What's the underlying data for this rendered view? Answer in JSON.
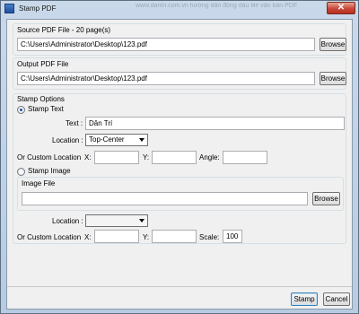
{
  "window": {
    "title": "Stamp PDF",
    "close_glyph": "✕",
    "background_text": "www.dantri.com.vn hướng dẫn đóng dấu file văn bản PDF"
  },
  "source": {
    "label": "Source PDF File - 20 page(s)",
    "path": "C:\\Users\\Administrator\\Desktop\\123.pdf",
    "browse_label": "Browse"
  },
  "output": {
    "label": "Output PDF File",
    "path": "C:\\Users\\Administrator\\Desktop\\123.pdf",
    "browse_label": "Browse"
  },
  "stamp_options": {
    "label": "Stamp Options",
    "stamp_text": {
      "radio_label": "Stamp Text",
      "selected": true,
      "text_label": "Text :",
      "text_value": "Dân Trí",
      "location_label": "Location :",
      "location_value": "Top-Center",
      "custom_location_label": "Or Custom Location",
      "x_label": "X:",
      "x_value": "",
      "y_label": "Y:",
      "y_value": "",
      "angle_label": "Angle:",
      "angle_value": ""
    },
    "stamp_image": {
      "radio_label": "Stamp Image",
      "selected": false,
      "image_file_label": "Image File",
      "image_path": "",
      "browse_label": "Browse",
      "location_label": "Location :",
      "location_value": "",
      "custom_location_label": "Or Custom Location",
      "x_label": "X:",
      "x_value": "",
      "y_label": "Y:",
      "y_value": "",
      "scale_label": "Scale:",
      "scale_value": "100"
    }
  },
  "footer": {
    "stamp_label": "Stamp",
    "cancel_label": "Cancel"
  }
}
